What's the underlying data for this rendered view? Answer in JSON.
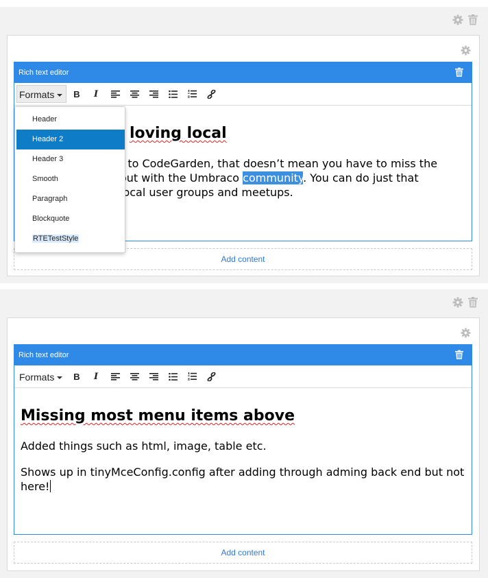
{
  "top_section": {
    "editor_title": "Rich text editor",
    "formats_label": "Formats",
    "heading_visible": "loving local",
    "paragraph": {
      "line1": "t to CodeGarden, that doesn’t mean you have to miss the",
      "line2_pre": "out with the Umbraco ",
      "line2_highlight": "community",
      "line2_post": ". You can do just that",
      "line3": "local user groups and meetups."
    },
    "add_content": "Add content",
    "formats_menu": {
      "items": [
        "Header",
        "Header 2",
        "Header 3",
        "Smooth",
        "Paragraph",
        "Blockquote",
        "RTETestStyle"
      ],
      "selected": "Header 2"
    }
  },
  "bottom_section": {
    "editor_title": "Rich text editor",
    "formats_label": "Formats",
    "heading": "Missing most menu items above",
    "paragraph1": "Added things such as html, image, table etc.",
    "paragraph2_line1": "Shows up in tinyMceConfig.config after adding through adming back end but not",
    "paragraph2_line2": "here!",
    "add_content": "Add content"
  },
  "toolbar_buttons": [
    "bold-icon",
    "italic-icon",
    "align-left-icon",
    "align-center-icon",
    "align-right-icon",
    "bullet-list-icon",
    "numbered-list-icon",
    "link-icon"
  ],
  "colors": {
    "accent": "#2e8ae6",
    "selected": "#0f7cc8",
    "link": "#2e7ad0"
  }
}
